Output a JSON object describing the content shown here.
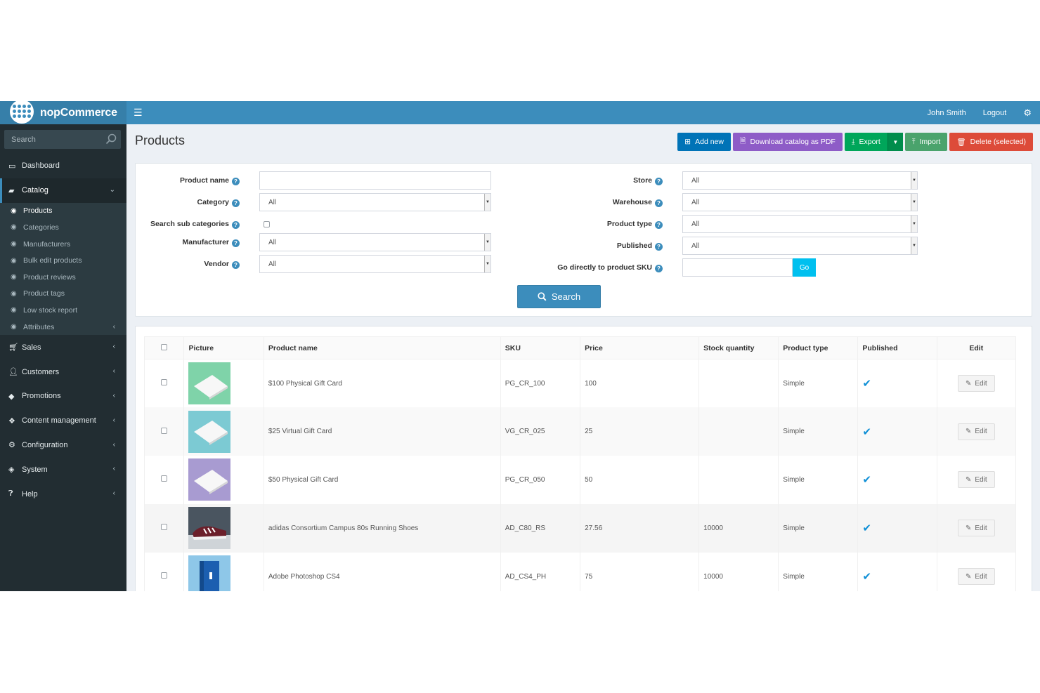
{
  "brand": {
    "name": "nopCommerce"
  },
  "header": {
    "user": "John Smith",
    "logout": "Logout"
  },
  "sidebar": {
    "search_placeholder": "Search",
    "items": [
      {
        "label": "Dashboard"
      },
      {
        "label": "Catalog"
      },
      {
        "label": "Sales"
      },
      {
        "label": "Customers"
      },
      {
        "label": "Promotions"
      },
      {
        "label": "Content management"
      },
      {
        "label": "Configuration"
      },
      {
        "label": "System"
      },
      {
        "label": "Help"
      }
    ],
    "catalog_sub": [
      {
        "label": "Products"
      },
      {
        "label": "Categories"
      },
      {
        "label": "Manufacturers"
      },
      {
        "label": "Bulk edit products"
      },
      {
        "label": "Product reviews"
      },
      {
        "label": "Product tags"
      },
      {
        "label": "Low stock report"
      },
      {
        "label": "Attributes"
      }
    ]
  },
  "page": {
    "title": "Products"
  },
  "actions": {
    "add_new": "Add new",
    "download_pdf": "Download catalog as PDF",
    "export": "Export",
    "import": "Import",
    "delete_selected": "Delete (selected)"
  },
  "filters": {
    "product_name": {
      "label": "Product name",
      "value": ""
    },
    "category": {
      "label": "Category",
      "value": "All"
    },
    "search_sub": {
      "label": "Search sub categories",
      "checked": false
    },
    "manufacturer": {
      "label": "Manufacturer",
      "value": "All"
    },
    "vendor": {
      "label": "Vendor",
      "value": "All"
    },
    "store": {
      "label": "Store",
      "value": "All"
    },
    "warehouse": {
      "label": "Warehouse",
      "value": "All"
    },
    "product_type": {
      "label": "Product type",
      "value": "All"
    },
    "published": {
      "label": "Published",
      "value": "All"
    },
    "sku": {
      "label": "Go directly to product SKU",
      "value": "",
      "go": "Go"
    },
    "search_button": "Search"
  },
  "table": {
    "headers": [
      "Picture",
      "Product name",
      "SKU",
      "Price",
      "Stock quantity",
      "Product type",
      "Published",
      "Edit"
    ],
    "edit_label": "Edit",
    "rows": [
      {
        "name": "$100 Physical Gift Card",
        "sku": "PG_CR_100",
        "price": "100",
        "stock": "",
        "type": "Simple",
        "published": true,
        "thumb_color": "#7fd3a9"
      },
      {
        "name": "$25 Virtual Gift Card",
        "sku": "VG_CR_025",
        "price": "25",
        "stock": "",
        "type": "Simple",
        "published": true,
        "thumb_color": "#7ccad3"
      },
      {
        "name": "$50 Physical Gift Card",
        "sku": "PG_CR_050",
        "price": "50",
        "stock": "",
        "type": "Simple",
        "published": true,
        "thumb_color": "#a89bd1"
      },
      {
        "name": "adidas Consortium Campus 80s Running Shoes",
        "sku": "AD_C80_RS",
        "price": "27.56",
        "stock": "10000",
        "type": "Simple",
        "published": true,
        "thumb_color": "#4a5560"
      },
      {
        "name": "Adobe Photoshop CS4",
        "sku": "AD_CS4_PH",
        "price": "75",
        "stock": "10000",
        "type": "Simple",
        "published": true,
        "thumb_color": "#8ec7e8"
      }
    ]
  },
  "colors": {
    "primary": "#3c8dbc",
    "sidebar": "#222d32",
    "success": "#00a65a",
    "danger": "#dd4b39",
    "purple": "#8e5cc7",
    "info": "#00c0ef"
  }
}
